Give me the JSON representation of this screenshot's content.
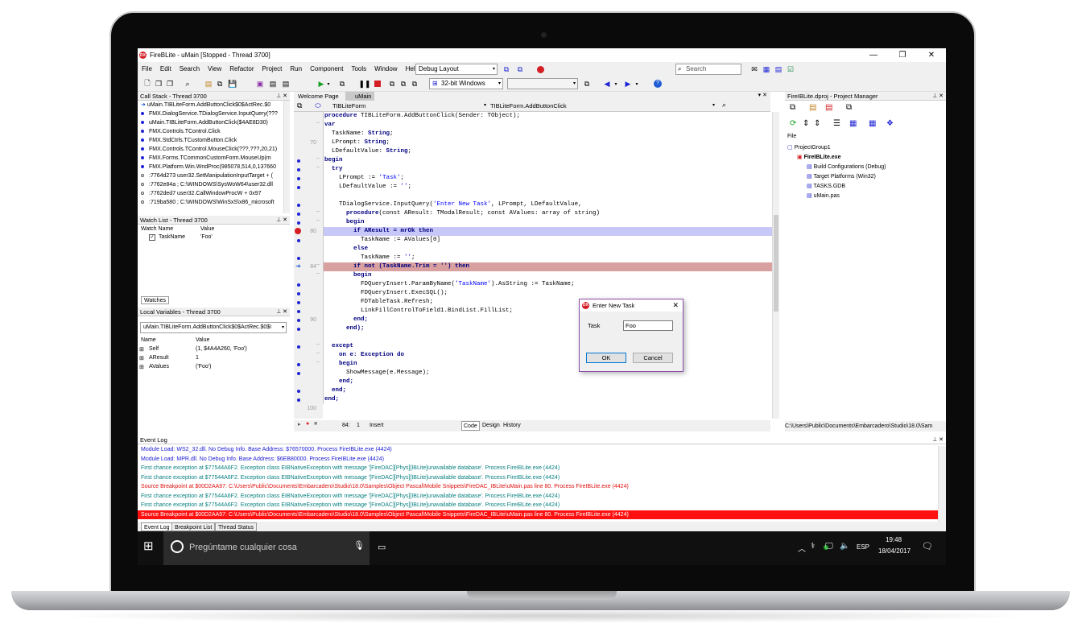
{
  "window": {
    "title": "FireBLite - uMain [Stopped - Thread 3700]",
    "icon_label": "DX",
    "min_glyph": "—",
    "max_glyph": "❐",
    "close_glyph": "✕"
  },
  "menu": [
    "File",
    "Edit",
    "Search",
    "View",
    "Refactor",
    "Project",
    "Run",
    "Component",
    "Tools",
    "Window",
    "Help"
  ],
  "toolbar": {
    "layout": "Debug Layout",
    "search_placeholder": "Search",
    "platform": "32-bit Windows",
    "arrow_down": "▾"
  },
  "callstack": {
    "title": "Call Stack - Thread 3700",
    "rows": [
      "uMain.TIBLiteForm.AddButtonClick$0$ActRec.$0",
      "FMX.DialogService.TDialogService.InputQuery(???",
      "uMain.TIBLiteForm.AddButtonClick($4AE8D30)",
      "FMX.Controls.TControl.Click",
      "FMX.StdCtrls.TCustomButton.Click",
      "FMX.Controls.TControl.MouseClick(???,???,20,21)",
      "FMX.Forms.TCommonCustomForm.MouseUp(m",
      "FMX.Platform.Win.WndProc(985078,514,0,137660",
      ":7764d273 user32.SetManipulationInputTarget + (",
      ":7762e84a ; C:\\WINDOWS\\SysWoW64\\user32.dll",
      ":7762ded7 user32.CallWindowProcW + 0x97",
      ":719ba580 ; C:\\WINDOWS\\WinSxS\\x86_microsoft"
    ]
  },
  "watch": {
    "title": "Watch List - Thread 3700",
    "col_name": "Watch Name",
    "col_value": "Value",
    "rows": [
      {
        "name": "TaskName",
        "value": "'Foo'"
      }
    ],
    "tab": "Watches"
  },
  "locals": {
    "title": "Local Variables - Thread 3700",
    "frame": "uMain.TIBLiteForm.AddButtonClick$0$ActRec.$0$I",
    "col_name": "Name",
    "col_value": "Value",
    "rows": [
      {
        "name": "Self",
        "value": "(1, $4A4A260, 'Foo')"
      },
      {
        "name": "AResult",
        "value": "1"
      },
      {
        "name": "AValues",
        "value": "('Foo')"
      }
    ]
  },
  "editor": {
    "tabs": [
      "Welcome Page",
      "uMain"
    ],
    "class_combo": "TIBLiteForm",
    "method_combo": "TIBLiteForm.AddButtonClick",
    "line_numbers": [
      {
        "n": "70",
        "row": 3
      },
      {
        "n": "80",
        "row": 13
      },
      {
        "n": "84",
        "row": 17
      },
      {
        "n": "90",
        "row": 23
      },
      {
        "n": "100",
        "row": 33
      }
    ],
    "status_pos": "84:",
    "status_num": "1",
    "status_mode": "Insert",
    "bottom_tabs": [
      "Code",
      "Design",
      "History"
    ]
  },
  "pm": {
    "title": "FireIBLite.dproj - Project Manager",
    "file_label": "File",
    "items": [
      {
        "label": "ProjectGroup1",
        "indent": 0,
        "bold": false
      },
      {
        "label": "FireIBLite.exe",
        "indent": 1,
        "bold": true
      },
      {
        "label": "Build Configurations (Debug)",
        "indent": 2,
        "bold": false
      },
      {
        "label": "Target Platforms (Win32)",
        "indent": 2,
        "bold": false
      },
      {
        "label": "TASKS.GDB",
        "indent": 2,
        "bold": false
      },
      {
        "label": "uMain.pas",
        "indent": 2,
        "bold": false
      }
    ],
    "path": "C:\\Users\\Public\\Documents\\Embarcadero\\Studio\\18.0\\Sam"
  },
  "eventlog": {
    "title": "Event Log",
    "rows": [
      {
        "text": "Module Load: WS2_32.dll. No Debug Info. Base Address: $76570000. Process FireIBLite.exe (4424)",
        "color": "#1a1ad4"
      },
      {
        "text": "Module Load: MPR.dll. No Debug Info. Base Address: $6EB80000. Process FireIBLite.exe (4424)",
        "color": "#1a1ad4"
      },
      {
        "text": "First chance exception at $77544A6F2. Exception class EIBNativeException with message '[FireDAC][Phys][IBLite]unavailable database'. Process FireIBLite.exe (4424)",
        "color": "#0a8080"
      },
      {
        "text": "First chance exception at $77544A6F2. Exception class EIBNativeException with message '[FireDAC][Phys][IBLite]unavailable database'. Process FireIBLite.exe (4424)",
        "color": "#0a8080"
      },
      {
        "text": "Source Breakpoint at $00D2AA97: C:\\Users\\Public\\Documents\\Embarcadero\\Studio\\18.0\\Samples\\Object Pascal\\Mobile Snippets\\FireDAC_IBLite\\uMain.pas line 80. Process FireIBLite.exe (4424)",
        "color": "#e01010"
      },
      {
        "text": "First chance exception at $77544A6F2. Exception class EIBNativeException with message '[FireDAC][Phys][IBLite]unavailable database'. Process FireIBLite.exe (4424)",
        "color": "#0a8080"
      },
      {
        "text": "First chance exception at $77544A6F2. Exception class EIBNativeException with message '[FireDAC][Phys][IBLite]unavailable database'. Process FireIBLite.exe (4424)",
        "color": "#0a8080"
      },
      {
        "text": "Source Breakpoint at $00D2AA97: C:\\Users\\Public\\Documents\\Embarcadero\\Studio\\18.0\\Samples\\Object Pascal\\Mobile Snippets\\FireDAC_IBLite\\uMain.pas line 80. Process FireIBLite.exe (4424)",
        "color": "#ffffff"
      }
    ],
    "tabs": [
      "Event Log",
      "Breakpoint List",
      "Thread Status"
    ]
  },
  "dialog": {
    "title": "Enter New Task",
    "label": "Task",
    "value": "Foo",
    "ok": "OK",
    "cancel": "Cancel",
    "close_glyph": "✕"
  },
  "taskbar": {
    "search_placeholder": "Pregúntame cualquier cosa",
    "lang": "ESP",
    "time": "19:48",
    "date": "18/04/2017"
  },
  "colors": {
    "exec_line": "#c8c8f8",
    "breakpoint_line": "#d9a0a0",
    "error_row": "#ff1010",
    "accent_blue": "#1e24d4"
  }
}
